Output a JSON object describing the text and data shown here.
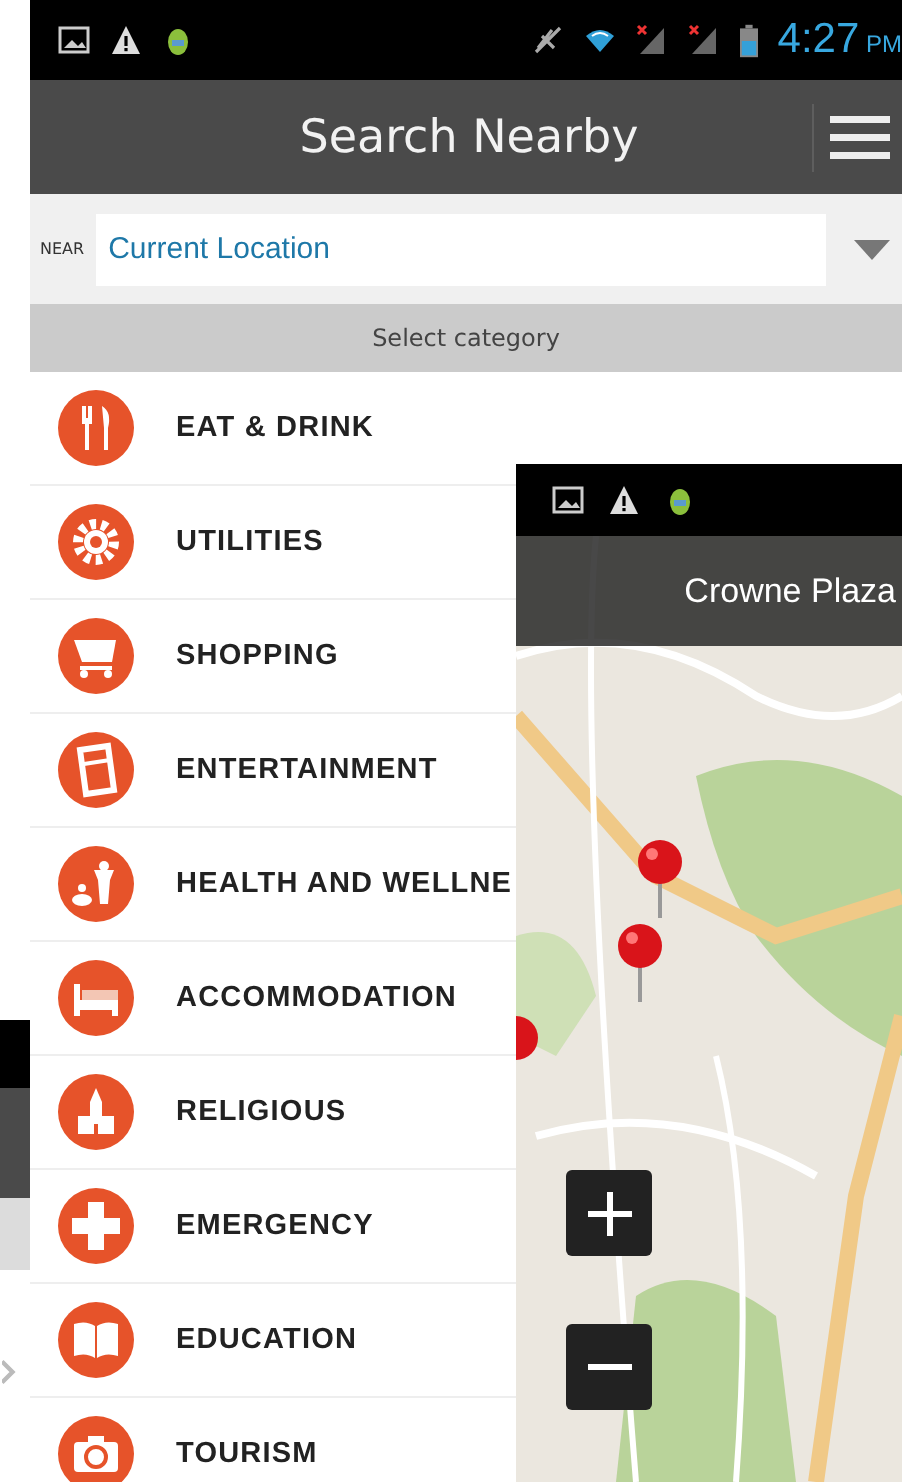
{
  "status_bar": {
    "time": "4:27",
    "meridiem": "PM"
  },
  "app_bar": {
    "title": "Search Nearby"
  },
  "near": {
    "label": "NEAR",
    "value": "Current Location"
  },
  "category_header": "Select category",
  "categories": [
    {
      "label": "EAT & DRINK",
      "kind": "food"
    },
    {
      "label": "UTILITIES",
      "kind": "gear"
    },
    {
      "label": "SHOPPING",
      "kind": "cart"
    },
    {
      "label": "ENTERTAINMENT",
      "kind": "ticket"
    },
    {
      "label": "HEALTH AND WELLNE",
      "kind": "health"
    },
    {
      "label": "ACCOMMODATION",
      "kind": "bed"
    },
    {
      "label": "RELIGIOUS",
      "kind": "temple"
    },
    {
      "label": "EMERGENCY",
      "kind": "cross"
    },
    {
      "label": "EDUCATION",
      "kind": "book"
    },
    {
      "label": "TOURISM",
      "kind": "camera"
    }
  ],
  "map_screen": {
    "title": "Crowne Plaza"
  }
}
